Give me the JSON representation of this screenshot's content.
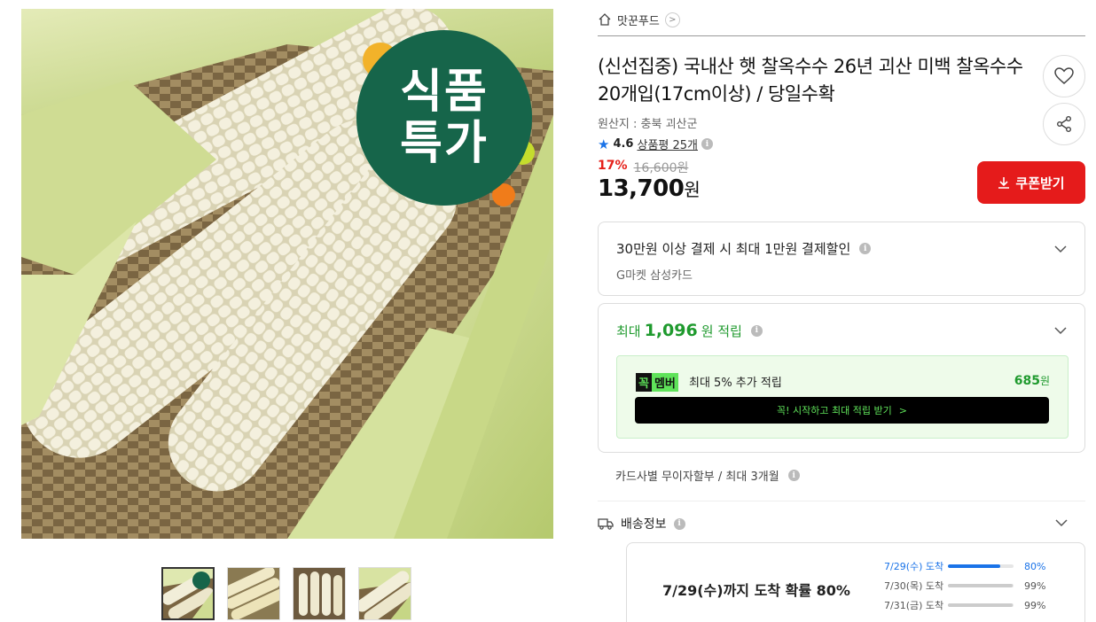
{
  "product_image": {
    "badge_line1": "식품",
    "badge_line2": "특가",
    "thumbnails": [
      "thumb-1",
      "thumb-2",
      "thumb-3",
      "thumb-4"
    ]
  },
  "store": {
    "name": "맛꾼푸드"
  },
  "product": {
    "title": "(신선집중) 국내산 햇 찰옥수수 26년 괴산 미백 찰옥수수 20개입(17cm이상) / 당일수확",
    "origin": "원산지 : 충북 괴산군",
    "rating": "4.6",
    "reviews": "상품평 25개",
    "discount": "17%",
    "original_price": "16,600원",
    "price": "13,700",
    "price_unit": "원"
  },
  "actions": {
    "coupon_label": "쿠폰받기"
  },
  "card_discount": {
    "title": "30만원 이상 결제 시 최대 1만원 결제할인",
    "subtitle": "G마켓 삼성카드"
  },
  "points": {
    "prefix": "최대",
    "amount": "1,096",
    "suffix": "원 적립",
    "member_logo_k": "꼭",
    "member_logo_m": "멤버",
    "member_text": "최대 5% 추가 적립",
    "member_amount": "685",
    "member_amount_unit": "원",
    "member_button": "꼭! 시작하고 최대 적립 받기",
    "member_button_arrow": ">"
  },
  "installment": {
    "text": "카드사별 무이자할부 / 최대 3개월"
  },
  "shipping": {
    "title": "배송정보",
    "headline": "7/29(수)까지 도착 확률 80%",
    "rows": [
      {
        "date": "7/29(수) 도착",
        "percent": "80%",
        "fill": 0.8
      },
      {
        "date": "7/30(목) 도착",
        "percent": "99%",
        "fill": 0.99
      },
      {
        "date": "7/31(금) 도착",
        "percent": "99%",
        "fill": 0.99
      }
    ]
  },
  "colors": {
    "accent_red": "#e51b1b",
    "points_green": "#1f9a2e",
    "member_green": "#5fe35a",
    "blue": "#1a73e8",
    "badge_green": "#16654a"
  },
  "icons": [
    "home-icon",
    "chevron-right-icon",
    "heart-icon",
    "share-icon",
    "star-icon",
    "info-icon",
    "download-icon",
    "chevron-down-icon",
    "truck-icon"
  ]
}
